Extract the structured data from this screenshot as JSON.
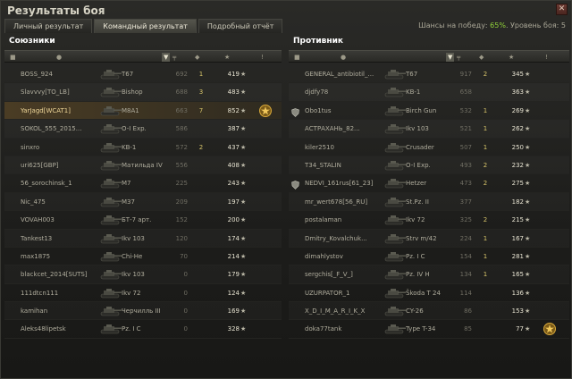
{
  "window": {
    "title": "Результаты боя",
    "close_label": "✕"
  },
  "tabs": [
    {
      "label": "Личный результат",
      "active": false
    },
    {
      "label": "Командный результат",
      "active": true
    },
    {
      "label": "Подробный отчёт",
      "active": false
    }
  ],
  "chances": {
    "prefix": "Шансы на победу:",
    "percent": "65%",
    "level_label": "Уровень боя:",
    "level": "5"
  },
  "header_icons": [
    "vehicle-class-icon",
    "player-icon",
    "sort-arrow-icon",
    "damage-icon",
    "frags-icon",
    "experience-icon",
    "medal-icon"
  ],
  "allies": {
    "title": "Союзники",
    "rows": [
      {
        "player": "BOSS_924",
        "vehicle": "T67",
        "damage": "692",
        "frags": "1",
        "xp": "419",
        "highlight": false,
        "badge": "",
        "medal": ""
      },
      {
        "player": "Slavvvy[TO_LB]",
        "vehicle": "Bishop",
        "damage": "688",
        "frags": "3",
        "xp": "483",
        "highlight": false,
        "badge": "",
        "medal": ""
      },
      {
        "player": "YarJagd[WCAT1]",
        "vehicle": "M8A1",
        "damage": "663",
        "frags": "7",
        "xp": "852",
        "highlight": true,
        "badge": "",
        "medal": "mastery-badge"
      },
      {
        "player": "SOKOL_555_2015...",
        "vehicle": "O-I Exp.",
        "damage": "586",
        "frags": "",
        "xp": "387",
        "highlight": false,
        "badge": "",
        "medal": ""
      },
      {
        "player": "sinxro",
        "vehicle": "KB-1",
        "damage": "572",
        "frags": "2",
        "xp": "437",
        "highlight": false,
        "badge": "",
        "medal": ""
      },
      {
        "player": "uri625[GBP]",
        "vehicle": "Матильда IV",
        "damage": "556",
        "frags": "",
        "xp": "408",
        "highlight": false,
        "badge": "",
        "medal": ""
      },
      {
        "player": "56_sorochinsk_1",
        "vehicle": "M7",
        "damage": "225",
        "frags": "",
        "xp": "243",
        "highlight": false,
        "badge": "",
        "medal": ""
      },
      {
        "player": "Nic_475",
        "vehicle": "M37",
        "damage": "209",
        "frags": "",
        "xp": "197",
        "highlight": false,
        "badge": "",
        "medal": ""
      },
      {
        "player": "VOVAH003",
        "vehicle": "БТ-7 арт.",
        "damage": "152",
        "frags": "",
        "xp": "200",
        "highlight": false,
        "badge": "",
        "medal": ""
      },
      {
        "player": "Tankest13",
        "vehicle": "Ikv 103",
        "damage": "120",
        "frags": "",
        "xp": "174",
        "highlight": false,
        "badge": "",
        "medal": ""
      },
      {
        "player": "max1875",
        "vehicle": "Chi-He",
        "damage": "70",
        "frags": "",
        "xp": "214",
        "highlight": false,
        "badge": "",
        "medal": ""
      },
      {
        "player": "blackcet_2014[SUTS]",
        "vehicle": "Ikv 103",
        "damage": "0",
        "frags": "",
        "xp": "179",
        "highlight": false,
        "badge": "",
        "medal": ""
      },
      {
        "player": "111dtcn111",
        "vehicle": "Ikv 72",
        "damage": "0",
        "frags": "",
        "xp": "124",
        "highlight": false,
        "badge": "",
        "medal": ""
      },
      {
        "player": "kamihan",
        "vehicle": "Черчилль III",
        "damage": "0",
        "frags": "",
        "xp": "169",
        "highlight": false,
        "badge": "",
        "medal": ""
      },
      {
        "player": "Aleks48lipetsk",
        "vehicle": "Pz. I C",
        "damage": "0",
        "frags": "",
        "xp": "328",
        "highlight": false,
        "badge": "",
        "medal": ""
      }
    ]
  },
  "enemies": {
    "title": "Противник",
    "rows": [
      {
        "player": "GENERAL_antibiotil_...",
        "vehicle": "T67",
        "damage": "917",
        "frags": "2",
        "xp": "345",
        "highlight": false,
        "badge": "",
        "medal": ""
      },
      {
        "player": "djdfy78",
        "vehicle": "KB-1",
        "damage": "658",
        "frags": "",
        "xp": "363",
        "highlight": false,
        "badge": "",
        "medal": ""
      },
      {
        "player": "Obo1tus",
        "vehicle": "Birch Gun",
        "damage": "532",
        "frags": "1",
        "xp": "269",
        "highlight": false,
        "badge": "shield",
        "medal": ""
      },
      {
        "player": "АСТРАХАНЬ_82...",
        "vehicle": "Ikv 103",
        "damage": "521",
        "frags": "1",
        "xp": "262",
        "highlight": false,
        "badge": "",
        "medal": ""
      },
      {
        "player": "kiler2510",
        "vehicle": "Crusader",
        "damage": "507",
        "frags": "1",
        "xp": "250",
        "highlight": false,
        "badge": "",
        "medal": ""
      },
      {
        "player": "T34_STALIN",
        "vehicle": "O-I Exp.",
        "damage": "493",
        "frags": "2",
        "xp": "232",
        "highlight": false,
        "badge": "",
        "medal": ""
      },
      {
        "player": "NEDVI_161rus[61_23]",
        "vehicle": "Hetzer",
        "damage": "473",
        "frags": "2",
        "xp": "275",
        "highlight": false,
        "badge": "shield",
        "medal": ""
      },
      {
        "player": "mr_wert678[56_RU]",
        "vehicle": "St.Pz. II",
        "damage": "377",
        "frags": "",
        "xp": "182",
        "highlight": false,
        "badge": "",
        "medal": ""
      },
      {
        "player": "postalaman",
        "vehicle": "Ikv 72",
        "damage": "325",
        "frags": "2",
        "xp": "215",
        "highlight": false,
        "badge": "",
        "medal": ""
      },
      {
        "player": "Dmitry_Kovalchuk...",
        "vehicle": "Strv m/42",
        "damage": "224",
        "frags": "1",
        "xp": "167",
        "highlight": false,
        "badge": "",
        "medal": ""
      },
      {
        "player": "dimahlystov",
        "vehicle": "Pz. I C",
        "damage": "154",
        "frags": "1",
        "xp": "281",
        "highlight": false,
        "badge": "",
        "medal": ""
      },
      {
        "player": "sergchis[_F_V_]",
        "vehicle": "Pz. IV H",
        "damage": "134",
        "frags": "1",
        "xp": "165",
        "highlight": false,
        "badge": "",
        "medal": ""
      },
      {
        "player": "UZURPATOR_1",
        "vehicle": "Škoda T 24",
        "damage": "114",
        "frags": "",
        "xp": "136",
        "highlight": false,
        "badge": "",
        "medal": ""
      },
      {
        "player": "X_D_I_M_A_R_I_K_X",
        "vehicle": "CY-26",
        "damage": "86",
        "frags": "",
        "xp": "153",
        "highlight": false,
        "badge": "",
        "medal": ""
      },
      {
        "player": "doka77tank",
        "vehicle": "Type T-34",
        "damage": "85",
        "frags": "",
        "xp": "77",
        "highlight": false,
        "badge": "",
        "medal": "mastery-badge"
      }
    ]
  },
  "colors": {
    "accent_green": "#8fd03a",
    "frags": "#d7c56a",
    "highlight": "#4a3c24"
  },
  "star_glyph": "★"
}
